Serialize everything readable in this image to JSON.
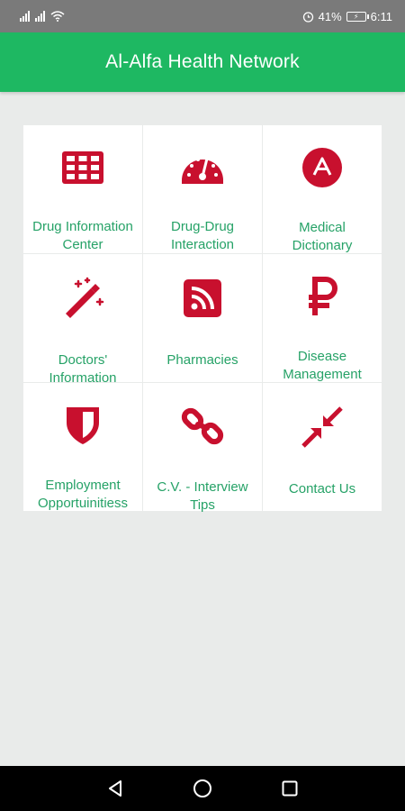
{
  "status_bar": {
    "battery_percent": "41%",
    "time": "6:11"
  },
  "app_bar": {
    "title": "Al-Alfa Health Network"
  },
  "colors": {
    "app_bar": "#1eb862",
    "icon": "#c8102e",
    "label": "#26a267",
    "background": "#e9ebea"
  },
  "menu": {
    "items": [
      {
        "label": "Drug Information\nCenter",
        "icon": "table-icon"
      },
      {
        "label": "Drug-Drug\nInteraction",
        "icon": "dashboard-gauge-icon"
      },
      {
        "label": "Medical\nDictionary",
        "icon": "letter-a-circle-icon"
      },
      {
        "label": "Doctors'\nInformation",
        "icon": "magic-wand-icon"
      },
      {
        "label": "Pharmacies",
        "icon": "rss-feed-icon"
      },
      {
        "label": "Disease\nManagement",
        "icon": "ruble-sign-icon"
      },
      {
        "label": "Employment\nOpportuinitiess",
        "icon": "shield-icon"
      },
      {
        "label": "C.V. - Interview\nTips",
        "icon": "chain-link-icon"
      },
      {
        "label": "Contact Us",
        "icon": "compress-arrows-icon"
      }
    ]
  },
  "nav_bar": {
    "buttons": [
      "back-icon",
      "home-icon",
      "recents-icon"
    ]
  }
}
